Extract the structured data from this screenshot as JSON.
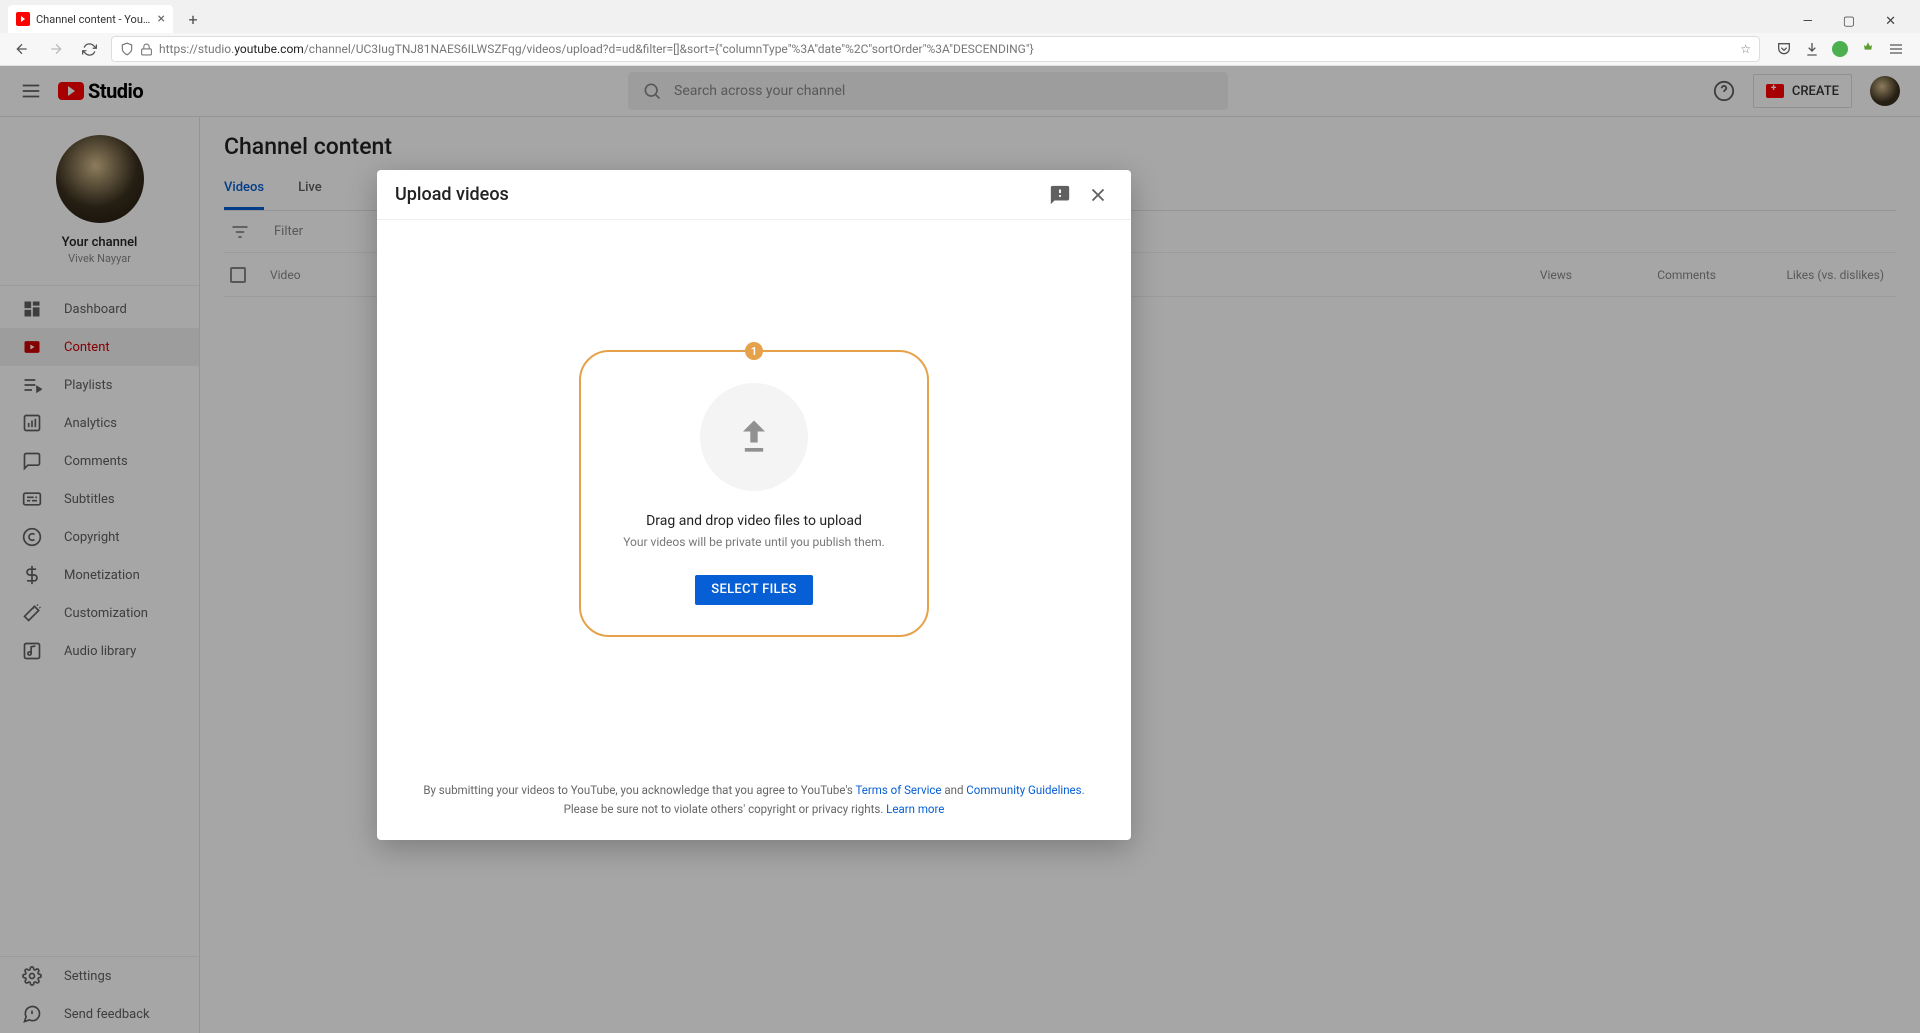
{
  "browser": {
    "tab_title": "Channel content - YouTube Stu",
    "url_prefix": "https://studio.",
    "url_host": "youtube.com",
    "url_path": "/channel/UC3IugTNJ81NAES6ILWSZFqg/videos/upload?d=ud&filter=[]&sort={\"columnType\"%3A\"date\"%2C\"sortOrder\"%3A\"DESCENDING\"}"
  },
  "header": {
    "logo_text": "Studio",
    "search_placeholder": "Search across your channel",
    "create_label": "CREATE"
  },
  "sidebar": {
    "channel_label": "Your channel",
    "channel_name": "Vivek Nayyar",
    "items": [
      {
        "label": "Dashboard"
      },
      {
        "label": "Content"
      },
      {
        "label": "Playlists"
      },
      {
        "label": "Analytics"
      },
      {
        "label": "Comments"
      },
      {
        "label": "Subtitles"
      },
      {
        "label": "Copyright"
      },
      {
        "label": "Monetization"
      },
      {
        "label": "Customization"
      },
      {
        "label": "Audio library"
      }
    ],
    "bottom": [
      {
        "label": "Settings"
      },
      {
        "label": "Send feedback"
      }
    ]
  },
  "main": {
    "page_title": "Channel content",
    "tabs": [
      {
        "label": "Videos"
      },
      {
        "label": "Live"
      }
    ],
    "filter_placeholder": "Filter",
    "columns": {
      "video": "Video",
      "views": "Views",
      "comments": "Comments",
      "likes": "Likes (vs. dislikes)"
    }
  },
  "modal": {
    "title": "Upload videos",
    "badge": "1",
    "dz_title": "Drag and drop video files to upload",
    "dz_sub": "Your videos will be private until you publish them.",
    "select_button": "SELECT FILES",
    "footer_pre": "By submitting your videos to YouTube, you acknowledge that you agree to YouTube's ",
    "tos": "Terms of Service",
    "and": " and ",
    "cg": "Community Guidelines",
    "period": ".",
    "copyright_line": "Please be sure not to violate others' copyright or privacy rights. ",
    "learn_more": "Learn more"
  }
}
